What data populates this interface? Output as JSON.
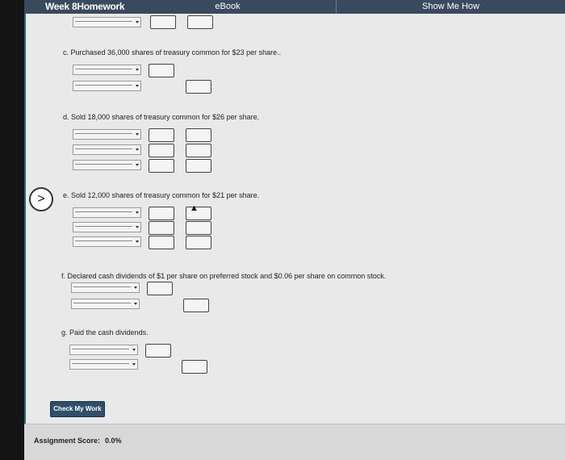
{
  "header": {
    "title": "Week 8Homework",
    "tab_ebook": "eBook",
    "tab_show_me": "Show Me How"
  },
  "questions": {
    "c": "c. Purchased 36,000 shares of treasury common for $23 per share..",
    "d": "d. Sold 18,000 shares of treasury common for $26 per share.",
    "e": "e. Sold 12,000 shares of treasury common for $21 per share.",
    "f": "f. Declared cash dividends of $1 per share on preferred stock and $0.06 per share on common stock.",
    "g": "g. Paid the cash dividends."
  },
  "nav": {
    "next_symbol": ">"
  },
  "actions": {
    "check_my_work": "Check My Work"
  },
  "footer": {
    "score_label": "Assignment Score:",
    "score_value": "0.0%"
  },
  "colors": {
    "header_bg": "#3a4a5e",
    "button_bg": "#2f4f6a",
    "content_bg": "#e9e9e9"
  }
}
